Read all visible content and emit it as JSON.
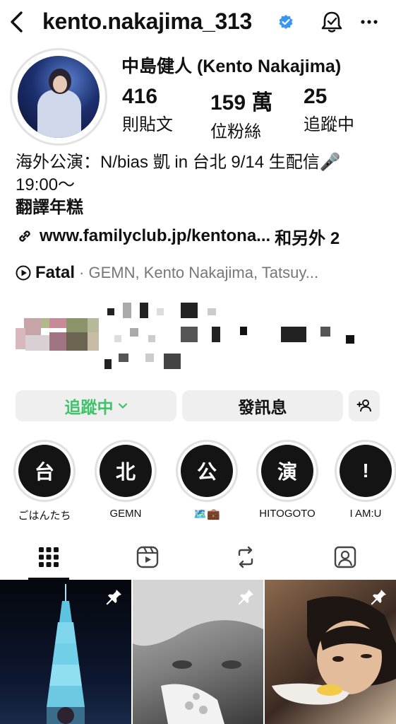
{
  "header": {
    "username": "kento.nakajima_313"
  },
  "profile": {
    "display_name": "中島健人 (Kento Nakajima)",
    "stats": [
      {
        "num": "416",
        "label": "則貼文"
      },
      {
        "num": "159 萬",
        "label": "位粉絲"
      },
      {
        "num": "25",
        "label": "追蹤中"
      }
    ],
    "bio_line1": "海外公演：N/bias 凱 in 台北 9/14 生配信🎤",
    "bio_line2": "19:00～",
    "bio_line3": "翻譯年糕",
    "link_text": "www.familyclub.jp/kentona...",
    "link_more": "和另外 2",
    "music_song": "Fatal",
    "music_artists": "· GEMN, Kento Nakajima, Tatsuy..."
  },
  "actions": {
    "following_label": "追蹤中",
    "message_label": "發訊息"
  },
  "highlights": [
    {
      "glyph": "台",
      "label": "ごはんたち"
    },
    {
      "glyph": "北",
      "label": "GEMN"
    },
    {
      "glyph": "公",
      "label": "🗺️💼"
    },
    {
      "glyph": "演",
      "label": "HITOGOTO"
    },
    {
      "glyph": "!",
      "label": "I AM:U"
    }
  ],
  "colors": {
    "following_text": "#3ec26a",
    "verified_badge": "#3897f0"
  }
}
